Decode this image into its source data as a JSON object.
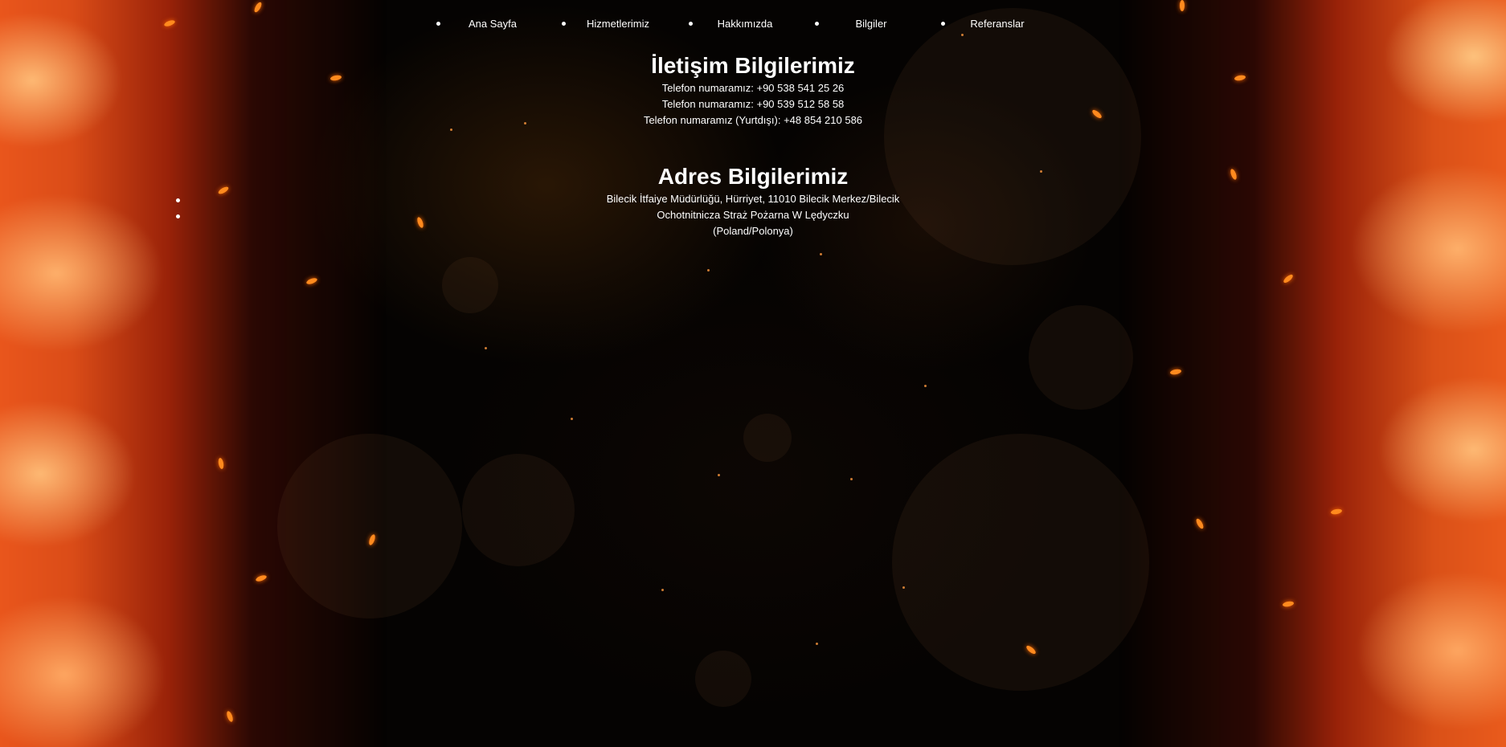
{
  "nav": {
    "items": [
      {
        "label": "Ana Sayfa"
      },
      {
        "label": "Hizmetlerimiz"
      },
      {
        "label": "Hakkımızda"
      },
      {
        "label": "Bilgiler"
      },
      {
        "label": "Referanslar"
      }
    ]
  },
  "contact": {
    "title": "İletişim Bilgilerimiz",
    "lines": [
      "Telefon numaramız:  +90 538 541 25 26",
      "Telefon numaramız:  +90 539 512 58 58",
      "Telefon numaramız (Yurtdışı):  +48 854 210 586"
    ]
  },
  "address": {
    "title": "Adres Bilgilerimiz",
    "lines": [
      "Bilecik İtfaiye Müdürlüğü, Hürriyet, 11010 Bilecik Merkez/Bilecik",
      "Ochotnitnicza Straż Pożarna W Lędyczku",
      "(Poland/Polonya)"
    ]
  },
  "colors": {
    "text": "#ffffff",
    "background": "#050302",
    "flame": "#f06020",
    "ember": "#ff8a1e"
  }
}
